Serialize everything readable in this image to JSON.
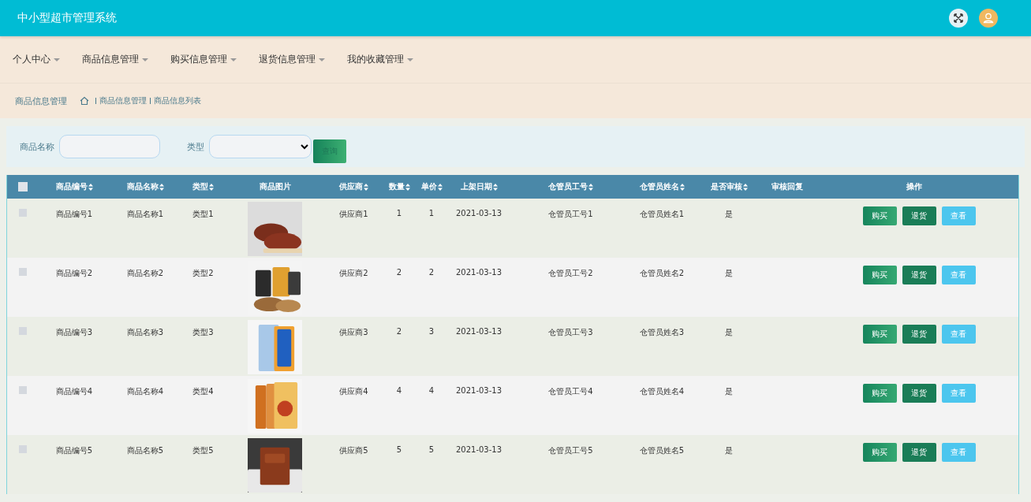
{
  "header": {
    "title": "中小型超市管理系统"
  },
  "nav": [
    {
      "label": "个人中心"
    },
    {
      "label": "商品信息管理"
    },
    {
      "label": "购买信息管理"
    },
    {
      "label": "退货信息管理"
    },
    {
      "label": "我的收藏管理"
    }
  ],
  "breadcrumb": {
    "title": "商品信息管理",
    "path": [
      "商品信息管理",
      "商品信息列表"
    ]
  },
  "search": {
    "fields": [
      {
        "label": "商品名称",
        "kind": "text"
      },
      {
        "label": "类型",
        "kind": "select"
      }
    ],
    "button": "查询"
  },
  "table": {
    "select_all": {
      "checked": false
    },
    "columns": [
      {
        "label": "商品编号",
        "sortable": true
      },
      {
        "label": "商品名称",
        "sortable": true
      },
      {
        "label": "类型",
        "sortable": true
      },
      {
        "label": "商品图片",
        "sortable": false
      },
      {
        "label": "供应商",
        "sortable": true
      },
      {
        "label": "数量",
        "sortable": true
      },
      {
        "label": "单价",
        "sortable": true
      },
      {
        "label": "上架日期",
        "sortable": true
      },
      {
        "label": "仓管员工号",
        "sortable": true
      },
      {
        "label": "仓管员姓名",
        "sortable": true
      },
      {
        "label": "是否审核",
        "sortable": true
      },
      {
        "label": "审核回复",
        "sortable": false
      },
      {
        "label": "操作",
        "sortable": false
      }
    ],
    "rows": [
      {
        "checked": false,
        "cells": [
          "商品编号1",
          "商品名称1",
          "类型1",
          {
            "kind": "picture"
          },
          "供应商1",
          "1",
          "1",
          "2021-03-13",
          "仓管员工号1",
          "仓管员姓名1",
          "是"
        ],
        "actions": [
          "购买",
          "退货",
          "查看"
        ]
      },
      {
        "checked": false,
        "cells": [
          "商品编号2",
          "商品名称2",
          "类型2",
          {
            "kind": "picture"
          },
          "供应商2",
          "2",
          "2",
          "2021-03-13",
          "仓管员工号2",
          "仓管员姓名2",
          "是"
        ],
        "actions": [
          "购买",
          "退货",
          "查看"
        ]
      },
      {
        "checked": false,
        "cells": [
          "商品编号3",
          "商品名称3",
          "类型3",
          {
            "kind": "picture"
          },
          "供应商3",
          "2",
          "3",
          "2021-03-13",
          "仓管员工号3",
          "仓管员姓名3",
          "是"
        ],
        "actions": [
          "购买",
          "退货",
          "查看"
        ]
      },
      {
        "checked": false,
        "cells": [
          "商品编号4",
          "商品名称4",
          "类型4",
          {
            "kind": "picture"
          },
          "供应商4",
          "4",
          "4",
          "2021-03-13",
          "仓管员工号4",
          "仓管员姓名4",
          "是"
        ],
        "actions": [
          "购买",
          "退货",
          "查看"
        ]
      },
      {
        "checked": false,
        "cells": [
          "商品编号5",
          "商品名称5",
          "类型5",
          {
            "kind": "picture"
          },
          "供应商5",
          "5",
          "5",
          "2021-03-13",
          "仓管员工号5",
          "仓管员姓名5",
          "是"
        ],
        "actions": [
          "购买",
          "退货",
          "查看"
        ]
      }
    ]
  }
}
